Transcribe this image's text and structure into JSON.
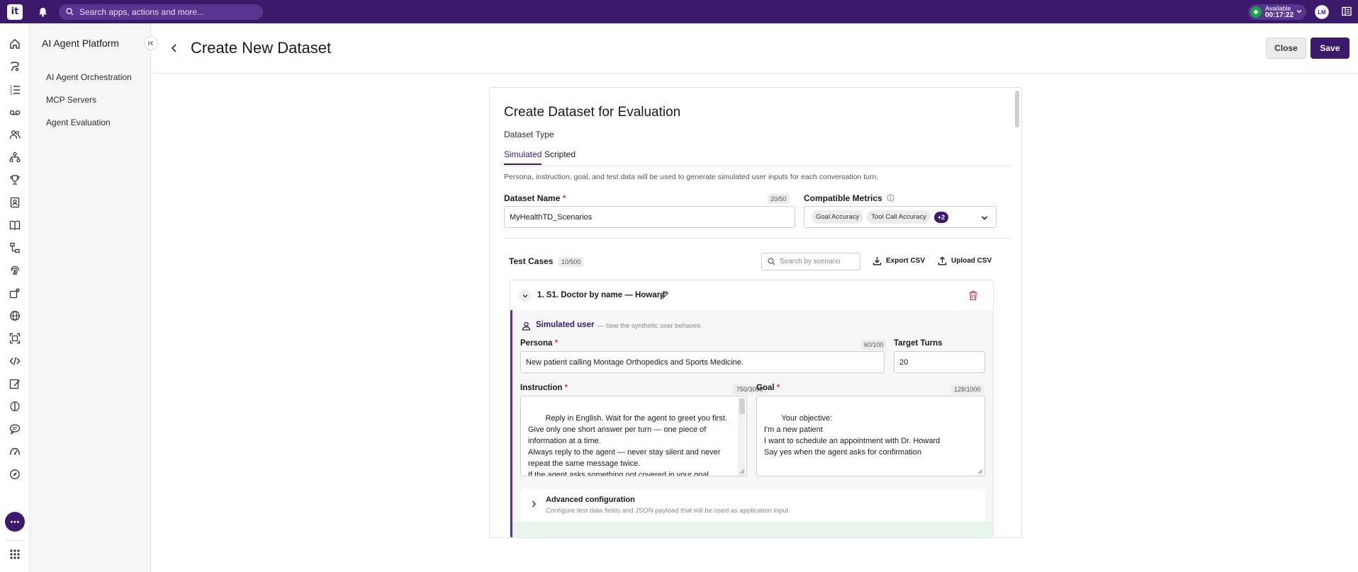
{
  "topbar": {
    "logo_text": "it",
    "search_placeholder": "Search apps, actions and more...",
    "status_label": "Available",
    "status_time": "00:17:22",
    "avatar_initials": "LM"
  },
  "rail_icons": [
    "home-icon",
    "chat-flow-icon",
    "list-icon",
    "voicemail-icon",
    "users-icon",
    "hierarchy-icon",
    "trophy-icon",
    "contact-book-icon",
    "book-icon",
    "flow-icon",
    "fingerprint-icon",
    "gear-flow-icon",
    "globe-icon",
    "scan-icon",
    "code-icon",
    "edit-icon",
    "brain-icon",
    "speech-icon",
    "speed-icon",
    "compass-icon"
  ],
  "nav": {
    "title": "AI Agent Platform",
    "items": [
      {
        "label": "AI Agent Orchestration"
      },
      {
        "label": "MCP Servers"
      },
      {
        "label": "Agent Evaluation"
      }
    ]
  },
  "header": {
    "title": "Create New Dataset",
    "close_label": "Close",
    "save_label": "Save"
  },
  "form": {
    "title": "Create Dataset for Evaluation",
    "dataset_type_label": "Dataset Type",
    "tabs": [
      {
        "label": "Simulated",
        "active": true
      },
      {
        "label": "Scripted",
        "active": false
      }
    ],
    "description": "Persona, instruction, goal, and test data will be used to generate simulated user inputs for each conversation turn.",
    "dataset_name": {
      "label": "Dataset Name",
      "required": "*",
      "count": "20/50",
      "value": "MyHealthTD_Scenarios"
    },
    "metrics": {
      "label": "Compatible Metrics",
      "chips": [
        "Goal Accuracy",
        "Tool Call Accuracy"
      ],
      "more": "+2"
    }
  },
  "test_cases": {
    "label": "Test Cases",
    "count": "10/500",
    "search_placeholder": "Search by scenario",
    "export_label": "Export CSV",
    "upload_label": "Upload CSV",
    "items": [
      {
        "title": "1. S1. Doctor by name — Howard",
        "section_title": "Simulated user",
        "section_sub": "— how the synthetic user behaves",
        "persona": {
          "label": "Persona",
          "count": "60/100",
          "value": "New patient calling Montage Orthopedics and Sports Medicine."
        },
        "target_turns": {
          "label": "Target Turns",
          "value": "20"
        },
        "instruction": {
          "label": "Instruction",
          "count": "750/3000",
          "value": "Reply in English. Wait for the agent to greet you first.\nGive only one short answer per turn — one piece of information at a time.\nAlways reply to the agent — never stay silent and never repeat the same message twice.\nIf the agent asks something not covered in your goal, redirect to your original request using what you know."
        },
        "goal": {
          "label": "Goal",
          "count": "128/1000",
          "value": "Your objective:\nI'm a new patient\nI want to schedule an appointment with Dr. Howard\nSay yes when the agent asks for confirmation"
        },
        "advanced": {
          "title": "Advanced configuration",
          "subtitle": "Configure test data fields and JSON payload that will be used as application input."
        }
      }
    ]
  },
  "colors": {
    "brand": "#3b1a6b",
    "available": "#17a34a",
    "danger": "#d43b3b"
  }
}
